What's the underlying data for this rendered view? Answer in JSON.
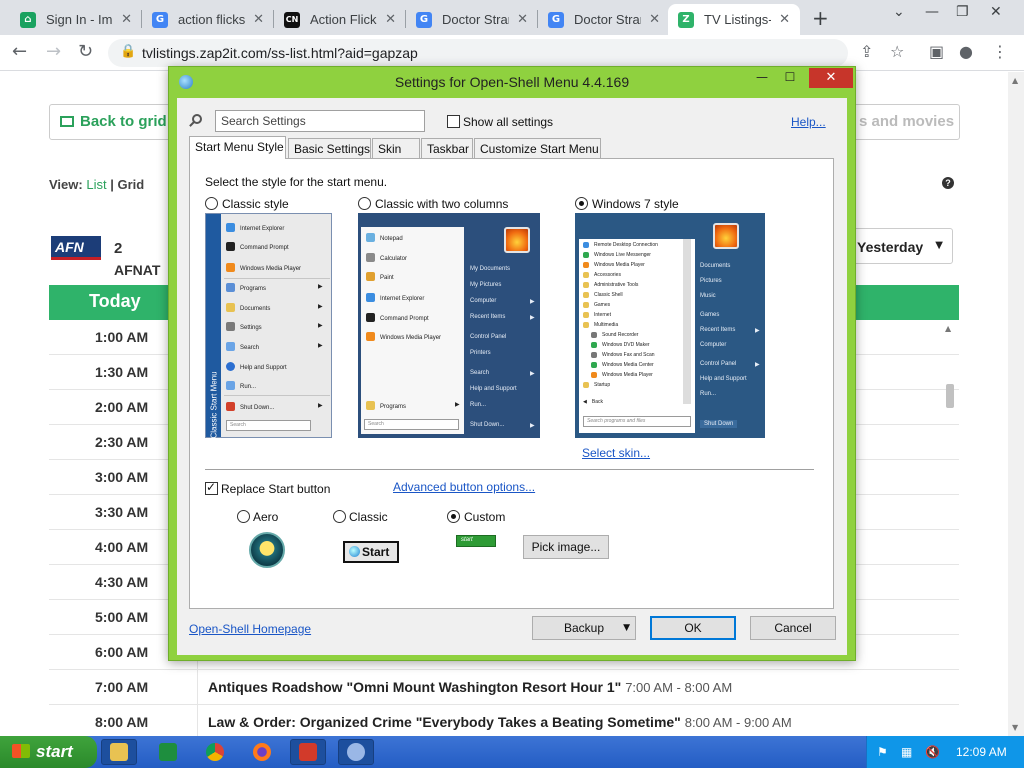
{
  "browser": {
    "tabs": [
      {
        "title": "Sign In - Img",
        "fav_color": "#1aa260",
        "fav_text": "⌂"
      },
      {
        "title": "action flicks",
        "fav_color": "#4285f4",
        "fav_text": "G"
      },
      {
        "title": "Action Flicks",
        "fav_color": "#111111",
        "fav_text": "CN"
      },
      {
        "title": "Doctor Stran",
        "fav_color": "#4285f4",
        "fav_text": "G"
      },
      {
        "title": "Doctor Stran",
        "fav_color": "#4285f4",
        "fav_text": "G"
      },
      {
        "title": "TV Listings-",
        "fav_color": "#2fb36a",
        "fav_text": "Z"
      }
    ],
    "new_tab": "+",
    "url": "tvlistings.zap2it.com/ss-list.html?aid=gapzap"
  },
  "page": {
    "back_to_grid": "Back to grid",
    "shows_and_movies": "s and movies",
    "view_label": "View:",
    "view_list": "List",
    "view_sep": "|",
    "view_grid": "Grid",
    "channel_logo": "AFN",
    "channel_number": "2",
    "channel_name": "AFNAT",
    "day_select": "Yesterday",
    "today_label": "Today",
    "schedule": [
      {
        "time": "1:00 AM",
        "program": "",
        "range": ""
      },
      {
        "time": "1:30 AM",
        "program": "",
        "range": ""
      },
      {
        "time": "2:00 AM",
        "program": "",
        "range": ""
      },
      {
        "time": "2:30 AM",
        "program": "",
        "range": ""
      },
      {
        "time": "3:00 AM",
        "program": "",
        "range": ""
      },
      {
        "time": "3:30 AM",
        "program": "",
        "range": ""
      },
      {
        "time": "4:00 AM",
        "program": "",
        "range": ""
      },
      {
        "time": "4:30 AM",
        "program": "",
        "range": ""
      },
      {
        "time": "5:00 AM",
        "program": "",
        "range": ""
      },
      {
        "time": "6:00 AM",
        "program": "",
        "range": ""
      },
      {
        "time": "7:00 AM",
        "program": "Antiques Roadshow \"Omni Mount Washington Resort Hour 1\"",
        "range": "7:00 AM - 8:00 AM"
      },
      {
        "time": "8:00 AM",
        "program": "Law & Order: Organized Crime \"Everybody Takes a Beating Sometime\"",
        "range": "8:00 AM - 9:00 AM"
      }
    ]
  },
  "dialog": {
    "title": "Settings for Open-Shell Menu 4.4.169",
    "search_placeholder": "Search Settings",
    "show_all": "Show all settings",
    "help": "Help...",
    "tabs": [
      "Start Menu Style",
      "Basic Settings",
      "Skin",
      "Taskbar",
      "Customize Start Menu"
    ],
    "prompt": "Select the style for the start menu.",
    "styles": [
      {
        "label": "Classic style",
        "selected": false
      },
      {
        "label": "Classic with two columns",
        "selected": false
      },
      {
        "label": "Windows 7 style",
        "selected": true
      }
    ],
    "classic_preview": {
      "band": "Classic Start Menu",
      "items": [
        "Internet Explorer",
        "Command Prompt",
        "Windows Media Player",
        "Programs",
        "Documents",
        "Settings",
        "Search",
        "Help and Support",
        "Run...",
        "Shut Down..."
      ],
      "search": "Search"
    },
    "two_col_preview": {
      "left": [
        "Notepad",
        "Calculator",
        "Paint",
        "Internet Explorer",
        "Command Prompt",
        "Windows Media Player",
        "Programs"
      ],
      "right": [
        "My Documents",
        "My Pictures",
        "Computer",
        "Recent Items",
        "Control Panel",
        "Printers",
        "Search",
        "Help and Support",
        "Run...",
        "Shut Down..."
      ],
      "search": "Search"
    },
    "w7_preview": {
      "left": [
        "Remote Desktop Connection",
        "Windows Live Messenger",
        "Windows Media Player",
        "Accessories",
        "Administrative Tools",
        "Classic Shell",
        "Games",
        "Internet",
        "Multimedia",
        "Sound Recorder",
        "Windows DVD Maker",
        "Windows Fax and Scan",
        "Windows Media Center",
        "Windows Media Player",
        "Startup",
        "Back"
      ],
      "right": [
        "Documents",
        "Pictures",
        "Music",
        "Games",
        "Recent Items",
        "Computer",
        "Control Panel",
        "Help and Support",
        "Run..."
      ],
      "search": "Search programs and files",
      "shutdown": "Shut Down"
    },
    "select_skin": "Select skin...",
    "replace_start": "Replace Start button",
    "replace_checked": true,
    "advanced": "Advanced button options...",
    "buttons": [
      {
        "label": "Aero",
        "selected": false
      },
      {
        "label": "Classic",
        "selected": false
      },
      {
        "label": "Custom",
        "selected": true
      }
    ],
    "classic_start_label": "Start",
    "custom_start_label": "start",
    "pick_image": "Pick image...",
    "homepage": "Open-Shell Homepage",
    "backup": "Backup",
    "ok": "OK",
    "cancel": "Cancel"
  },
  "taskbar": {
    "start": "start",
    "clock": "12:09 AM"
  }
}
